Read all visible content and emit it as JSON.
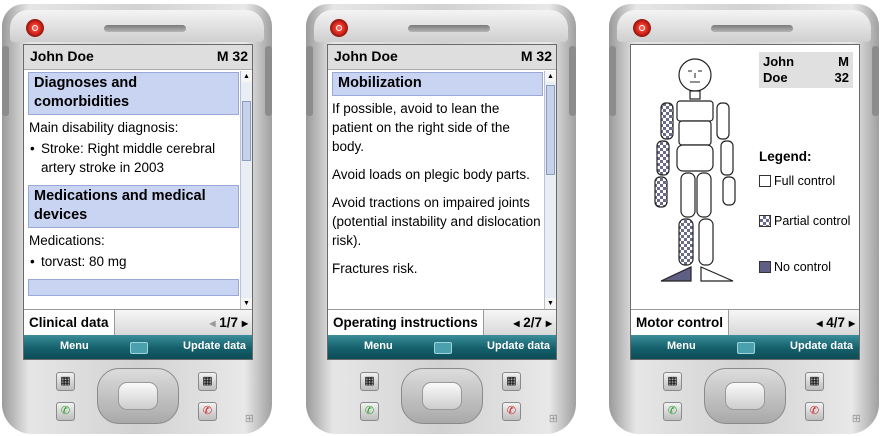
{
  "patient": {
    "name": "John Doe",
    "first_name": "John",
    "last_name": "Doe",
    "sex_age": "M 32",
    "sex": "M",
    "age": "32"
  },
  "softkeys": {
    "left": "Menu",
    "right": "Update data"
  },
  "screens": [
    {
      "tab": "Clinical data",
      "page": "1/7",
      "sections": [
        {
          "title": "Diagnoses and comorbidities",
          "label": "Main disability diagnosis:",
          "item": "Stroke: Right middle cerebral artery stroke in 2003"
        },
        {
          "title": "Medications and medical devices",
          "label": "Medications:",
          "item": "torvast: 80 mg"
        }
      ]
    },
    {
      "tab": "Operating instructions",
      "page": "2/7",
      "section_title": "Mobilization",
      "paragraphs": [
        "If possible, avoid to lean the patient on the right side of the body.",
        "Avoid loads on plegic body parts.",
        "Avoid tractions on impaired joints (potential instability and dislocation risk).",
        "Fractures risk."
      ]
    },
    {
      "tab": "Motor control",
      "page": "4/7",
      "legend_title": "Legend:",
      "legend": [
        "Full control",
        "Partial control",
        "No control"
      ],
      "colors": {
        "partial": "#6a6a8c",
        "none": "#5f5f86"
      },
      "body_segments": {
        "full_control": [
          "head",
          "neck",
          "torso",
          "pelvis",
          "right-upper-arm",
          "right-forearm",
          "right-hand",
          "right-thigh",
          "right-shin",
          "right-foot",
          "left-thigh"
        ],
        "partial_control": [
          "left-upper-arm",
          "left-forearm",
          "left-hand",
          "left-shin"
        ],
        "no_control": [
          "left-foot"
        ]
      }
    }
  ],
  "colors": {
    "section_bg": "#c9d3f2",
    "softbar": "#15606c",
    "header_bg": "#dedede"
  }
}
